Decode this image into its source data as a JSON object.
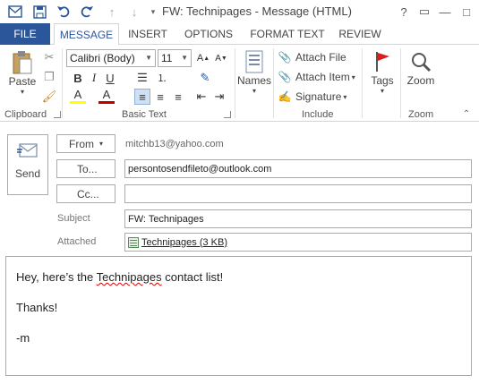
{
  "title_bar": {
    "title": "FW: Technipages - Message (HTML)",
    "qat_icons": [
      "app-icon",
      "save-icon",
      "undo-icon",
      "redo-icon",
      "up-icon",
      "down-icon",
      "customize-icon"
    ],
    "window_controls": {
      "help": "?",
      "restore": "▭",
      "minimize": "—",
      "maximize": "□",
      "close": "✕"
    }
  },
  "tabs": [
    {
      "label": "FILE"
    },
    {
      "label": "MESSAGE"
    },
    {
      "label": "INSERT"
    },
    {
      "label": "OPTIONS"
    },
    {
      "label": "FORMAT TEXT"
    },
    {
      "label": "REVIEW"
    }
  ],
  "ribbon": {
    "clipboard": {
      "paste": "Paste",
      "group_label": "Clipboard"
    },
    "basic_text": {
      "font": "Calibri (Body)",
      "size": "11",
      "bold": "B",
      "italic": "I",
      "underline": "U",
      "highlight": "A",
      "font_color": "A",
      "group_label": "Basic Text"
    },
    "names": {
      "label": "Names"
    },
    "include": {
      "attach_file": "Attach File",
      "attach_item": "Attach Item",
      "signature": "Signature",
      "group_label": "Include"
    },
    "tags": {
      "label": "Tags"
    },
    "zoom": {
      "label": "Zoom",
      "group_label": "Zoom"
    }
  },
  "message": {
    "send": "Send",
    "from_label": "From",
    "from_value": "mitchb13@yahoo.com",
    "to_label": "To...",
    "to_value": "persontosendfileto@outlook.com",
    "cc_label": "Cc...",
    "cc_value": "",
    "subject_label": "Subject",
    "subject_value": "FW: Technipages",
    "attached_label": "Attached",
    "attachment_name": "Technipages (3 KB)",
    "body_lines": {
      "line1_pre": "Hey, here’s the ",
      "line1_word": "Technipages",
      "line1_post": " contact list!",
      "line2": "Thanks!",
      "line3": "-m"
    }
  },
  "colors": {
    "accent": "#2b579a",
    "highlight_yellow": "#ffff00",
    "font_red": "#c00000",
    "tag_red": "#d81e1e"
  }
}
